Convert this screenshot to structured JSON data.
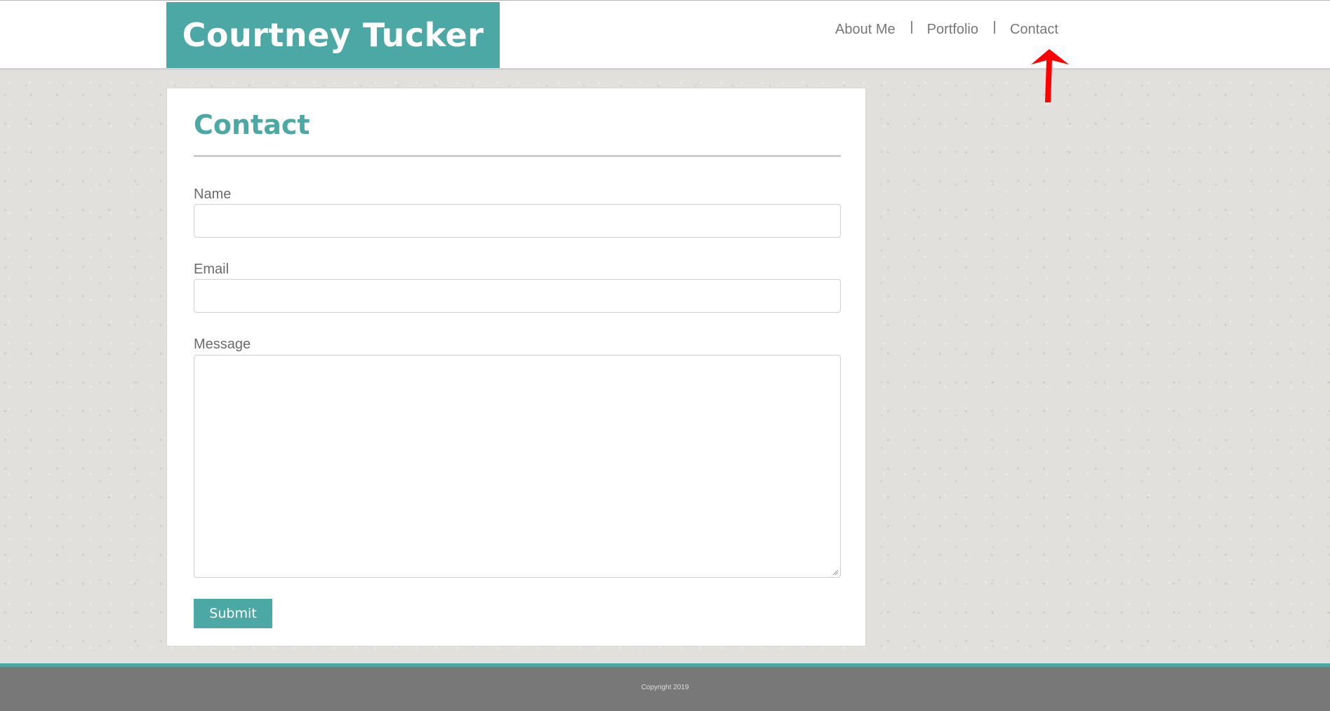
{
  "header": {
    "brand": "Courtney Tucker",
    "nav": [
      {
        "label": "About Me"
      },
      {
        "label": "Portfolio"
      },
      {
        "label": "Contact"
      }
    ]
  },
  "annotation": {
    "icon": "red-arrow-up-icon",
    "color": "#ff0000"
  },
  "contact": {
    "title": "Contact",
    "fields": {
      "name_label": "Name",
      "name_value": "",
      "email_label": "Email",
      "email_value": "",
      "message_label": "Message",
      "message_value": ""
    },
    "submit_label": "Submit"
  },
  "footer": {
    "copyright": "Copyright 2019"
  },
  "colors": {
    "accent": "#4ca8a5",
    "footer_bg": "#787878",
    "page_bg": "#e2e0dc"
  }
}
